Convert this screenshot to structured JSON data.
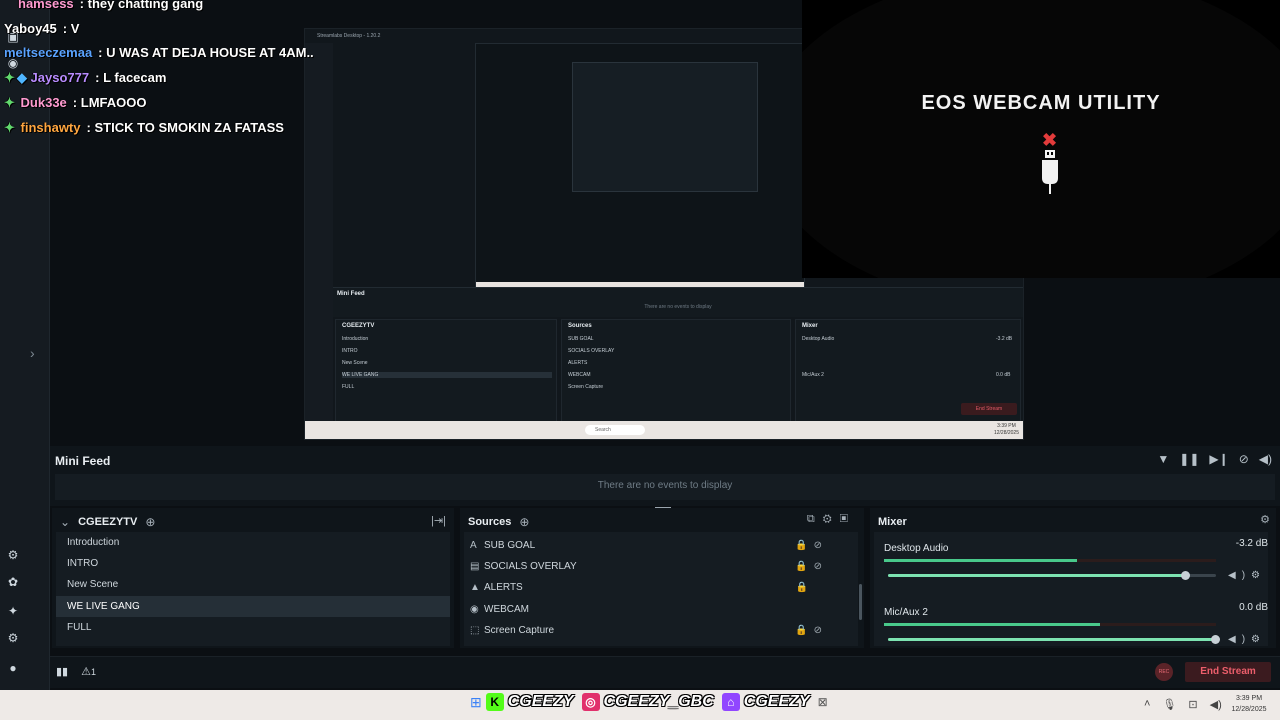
{
  "chat": [
    {
      "name": "hamsess",
      "message": "they chatting gang",
      "color": "#ff9bd1"
    },
    {
      "name": "Yaboy45",
      "message": "V",
      "color": "#ffffff"
    },
    {
      "name": "meltseczemaa",
      "message": "U WAS AT DEJA HOUSE AT 4AM..",
      "color": "#5aa3ff"
    },
    {
      "name": "Jayso777",
      "message": "L facecam",
      "color": "#b98cff"
    },
    {
      "name": "Duk33e",
      "message": "LMFAOOO",
      "color": "#ff9bd1"
    },
    {
      "name": "finshawty",
      "message": "STICK TO SMOKIN ZA FATASS",
      "color": "#ffa640"
    }
  ],
  "webcam": {
    "title": "EOS WEBCAM UTILITY",
    "icon": "usb-disconnected-icon"
  },
  "nested": {
    "window_title": "Streamlabs Desktop - 1.20.2",
    "mini_feed": "Mini Feed",
    "empty": "There are no events to display",
    "scene_collection": "CGEEZYTV",
    "scenes": [
      "Introduction",
      "INTRO",
      "New Scene",
      "WE LIVE GANG",
      "FULL"
    ],
    "sources_title": "Sources",
    "sources": [
      "SUB GOAL",
      "SOCIALS OVERLAY",
      "ALERTS",
      "WEBCAM",
      "Screen Capture"
    ],
    "mixer_title": "Mixer",
    "channels": [
      {
        "name": "Desktop Audio",
        "db": "-3.2 dB"
      },
      {
        "name": "Mic/Aux 2",
        "db": "0.0 dB"
      }
    ],
    "end_stream": "End Stream",
    "search": "Search",
    "clock": {
      "time": "3:39 PM",
      "date": "12/28/2025"
    }
  },
  "mini_feed": {
    "title": "Mini Feed",
    "empty": "There are no events to display"
  },
  "scenes": {
    "collection": "CGEEZYTV",
    "items": [
      "Introduction",
      "INTRO",
      "New Scene",
      "WE LIVE GANG",
      "FULL"
    ],
    "selected_index": 3
  },
  "sources": {
    "title": "Sources",
    "items": [
      {
        "name": "SUB GOAL",
        "icon": "text-icon"
      },
      {
        "name": "SOCIALS OVERLAY",
        "icon": "image-icon"
      },
      {
        "name": "ALERTS",
        "icon": "alert-icon"
      },
      {
        "name": "WEBCAM",
        "icon": "camera-icon"
      },
      {
        "name": "Screen Capture",
        "icon": "screen-capture-icon"
      }
    ]
  },
  "mixer": {
    "title": "Mixer",
    "channels": [
      {
        "name": "Desktop Audio",
        "db": "-3.2 dB",
        "level": 0.58,
        "volume": 0.91
      },
      {
        "name": "Mic/Aux 2",
        "db": "0.0 dB",
        "level": 0.65,
        "volume": 1.0
      }
    ]
  },
  "footer": {
    "rec": "REC",
    "end_stream": "End Stream",
    "alert_count": "1"
  },
  "taskbar": {
    "handles": [
      {
        "platform": "kick-icon",
        "name": "CGEEZY",
        "color": "#53fc18"
      },
      {
        "platform": "instagram-icon",
        "name": "CGEEZY_GBC",
        "color": "#e1306c"
      },
      {
        "platform": "twitch-icon",
        "name": "CGEEZY",
        "color": "#9146ff"
      }
    ],
    "time": "3:39 PM",
    "date": "12/28/2025"
  }
}
